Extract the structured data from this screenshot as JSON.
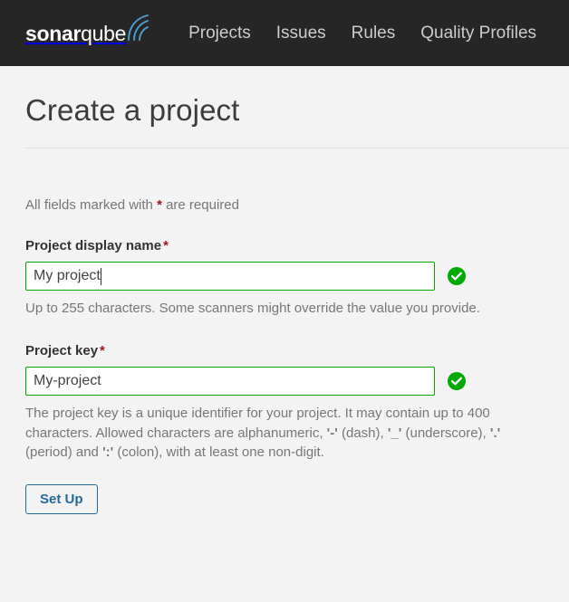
{
  "header": {
    "brand": {
      "name_bold": "sonar",
      "name_light": "qube",
      "arc_color": "#4b9fd5"
    },
    "nav_links": [
      {
        "label": "Projects"
      },
      {
        "label": "Issues"
      },
      {
        "label": "Rules"
      },
      {
        "label": "Quality Profiles"
      }
    ],
    "background_color": "#262626"
  },
  "main": {
    "page_title": "Create a project",
    "required_note": {
      "before": "All fields marked with ",
      "star": "*",
      "after": " are required"
    },
    "fields": [
      {
        "label": "Project display name",
        "required_star": "*",
        "value": "My project",
        "placeholder": "",
        "valid": true,
        "has_caret": true,
        "help_text": "Up to 255 characters. Some scanners might override the value you provide."
      },
      {
        "label": "Project key",
        "required_star": "*",
        "value": "My-project",
        "placeholder": "",
        "valid": true,
        "has_caret": false,
        "help_parts": {
          "p1": "The project key is a unique identifier for your project. It may contain up to 400 characters. Allowed characters are alphanumeric, ",
          "dash": "'-'",
          "p2": " (dash), ",
          "underscore": "'_'",
          "p3": " (underscore), ",
          "period": "'.'",
          "p4": " (period) and ",
          "colon": "':'",
          "p5": " (colon), with at least one non-digit."
        }
      }
    ],
    "submit_button": "Set Up",
    "colors": {
      "valid_green": "#00aa00",
      "required_red": "#a4161a",
      "button_blue": "#236a97",
      "background": "#f3f3f3"
    }
  }
}
